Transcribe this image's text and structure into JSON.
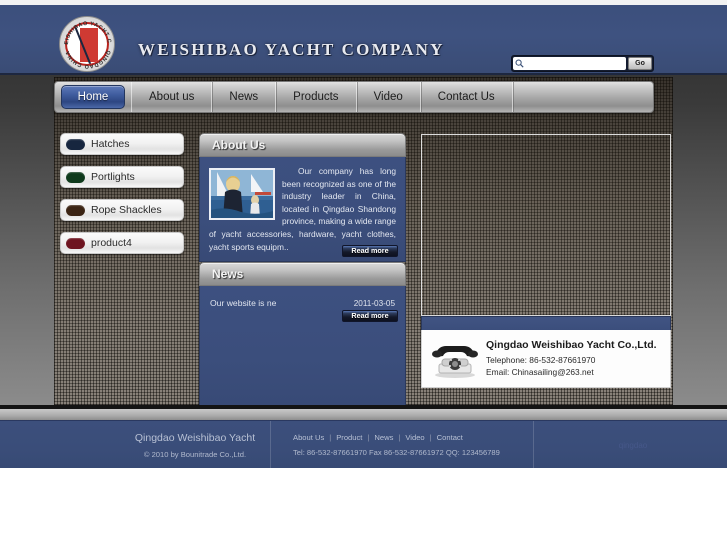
{
  "header": {
    "site_title": "WEISHIBAO  YACHT  COMPANY",
    "logo_icon": "circular-yacht-club-emblem-icon",
    "logo_arc_top": "WEISHIBAO YACHT COMPANY",
    "logo_arc_bottom": "QINGDAO CHINA",
    "brand_blue": "#3e5280"
  },
  "search": {
    "icon": "magnifier-icon",
    "value": "",
    "placeholder": "",
    "go_label": "Go"
  },
  "nav": {
    "items": [
      {
        "label": "Home",
        "active": true
      },
      {
        "label": "About us",
        "active": false
      },
      {
        "label": "News",
        "active": false
      },
      {
        "label": "Products",
        "active": false
      },
      {
        "label": "Video",
        "active": false
      },
      {
        "label": "Contact Us",
        "active": false
      }
    ],
    "active_color": "#3f5c9e"
  },
  "sidebar": {
    "items": [
      {
        "label": "Hatches",
        "color": "#17263f"
      },
      {
        "label": "Portlights",
        "color": "#0f3a1c"
      },
      {
        "label": "Rope Shackles",
        "color": "#3b2414"
      },
      {
        "label": "product4",
        "color": "#6e1420"
      }
    ]
  },
  "about_panel": {
    "title": "About Us",
    "photo_icon": "woman-sailing-yacht-photo",
    "body": "Our company has long been recognized as one of the industry leader in China, located in Qingdao Shandong province, making a wide range of yacht accessories, hardware, yacht clothes, yacht sports equipm..",
    "read_more_label": "Read more"
  },
  "news_panel": {
    "title": "News",
    "items": [
      {
        "title": "Our website is ne",
        "date": "2011-03-05"
      }
    ],
    "read_more_label": "Read more"
  },
  "contact_panel": {
    "icon": "vintage-telephone-icon",
    "company": "Qingdao Weishibao Yacht Co.,Ltd.",
    "telephone": "Telephone: 86-532-87661970",
    "email": "Email: Chinasailing@263.net"
  },
  "footer": {
    "brand": "Qingdao Weishibao Yacht",
    "copyright": "© 2010 by Bounitrade Co.,Ltd.",
    "links": [
      "About Us",
      "Product",
      "News",
      "Video",
      "Contact"
    ],
    "link_divider": "|",
    "contact_line": "Tel: 86-532-87661970 Fax 86-532-87661972 QQ: 123456789",
    "faint_text": "qingdao"
  }
}
